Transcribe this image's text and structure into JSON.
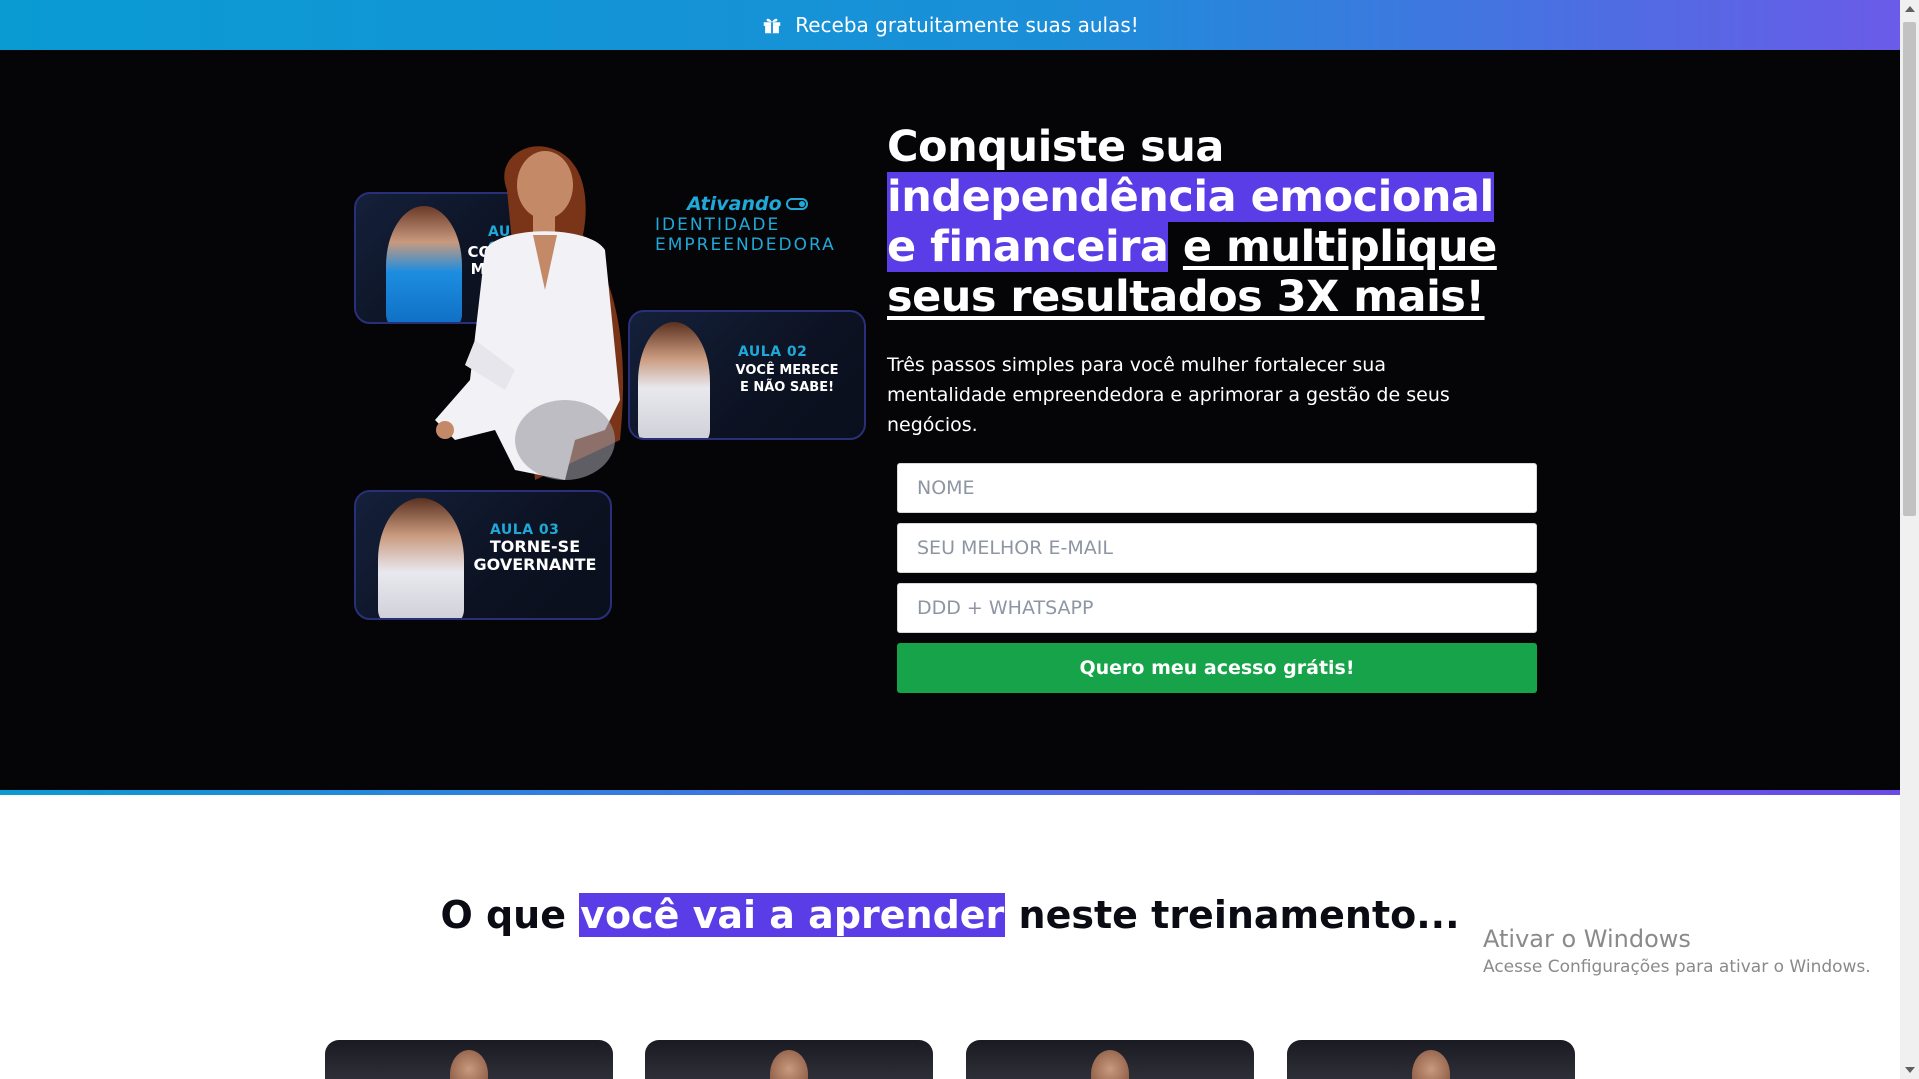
{
  "banner": {
    "icon": "gift-icon",
    "text": "Receba gratuitamente suas aulas!"
  },
  "hero": {
    "brand": {
      "line1": "Ativando",
      "line2": "IDENTIDADE",
      "line3": "EMPREENDEDORA"
    },
    "cards": [
      {
        "aula": "AULA 01",
        "title_l1": "COMO T",
        "title_l2": "MARCA"
      },
      {
        "aula": "AULA 02",
        "title_l1": "VOCÊ MERECE",
        "title_l2": "E NÃO SABE!"
      },
      {
        "aula": "AULA 03",
        "title_l1": "TORNE-SE",
        "title_l2": "GOVERNANTE"
      }
    ],
    "headline": {
      "part1": "Conquiste sua ",
      "part2_highlight": "independência emocional e financeira",
      "part3": " ",
      "part4_underline": "e multiplique seus resultados 3X mais!"
    },
    "subtitle": "Três passos simples para você mulher fortalecer sua mentalidade empreendedora e aprimorar a gestão de seus negócios."
  },
  "form": {
    "name_placeholder": "NOME",
    "email_placeholder": "SEU MELHOR E-MAIL",
    "phone_placeholder": "DDD + WHATSAPP",
    "submit_label": "Quero meu acesso grátis!"
  },
  "section2": {
    "title_before": "O que ",
    "title_highlight": "você vai a aprender",
    "title_after": " neste treinamento..."
  },
  "watermark": {
    "title": "Ativar o Windows",
    "subtitle": "Acesse Configurações para ativar o Windows."
  },
  "colors": {
    "accent_purple": "#5a3de6",
    "accent_blue": "#1fa8d8",
    "cta_green": "#17a34a",
    "hero_bg": "#050508"
  }
}
